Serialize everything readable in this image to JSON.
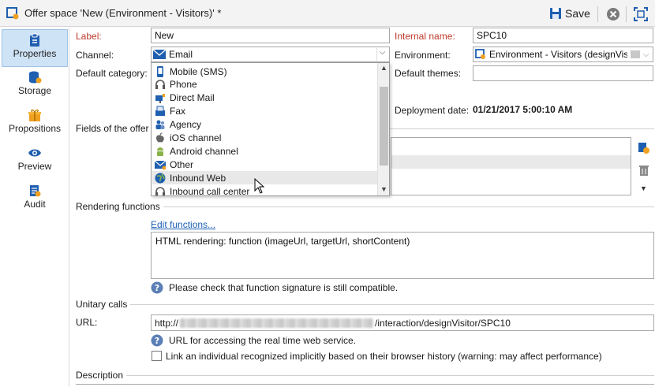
{
  "window": {
    "title": "Offer space 'New (Environment - Visitors)' *",
    "save_label": "Save"
  },
  "sidebar": {
    "items": [
      {
        "label": "Properties",
        "active": true,
        "icon": "clipboard-icon"
      },
      {
        "label": "Storage",
        "icon": "database-icon"
      },
      {
        "label": "Propositions",
        "icon": "gift-icon"
      },
      {
        "label": "Preview",
        "icon": "eye-icon"
      },
      {
        "label": "Audit",
        "icon": "audit-icon"
      }
    ]
  },
  "form": {
    "label_label": "Label:",
    "label_value": "New",
    "internal_name_label": "Internal name:",
    "internal_name_value": "SPC10",
    "channel_label": "Channel:",
    "channel_value": "Email",
    "environment_label": "Environment:",
    "environment_value": "Environment - Visitors (designVis",
    "default_category_label": "Default category:",
    "default_themes_label": "Default themes:",
    "deployment_date_label": "Deployment date:",
    "deployment_date_value": "01/21/2017 5:00:10 AM",
    "fields_label": "Fields of the offer"
  },
  "channel_dropdown": {
    "options": [
      {
        "label": "Mobile (SMS)",
        "icon": "mobile-icon"
      },
      {
        "label": "Phone",
        "icon": "headset-icon"
      },
      {
        "label": "Direct Mail",
        "icon": "mailbox-icon"
      },
      {
        "label": "Fax",
        "icon": "fax-icon"
      },
      {
        "label": "Agency",
        "icon": "people-icon"
      },
      {
        "label": "iOS channel",
        "icon": "apple-icon"
      },
      {
        "label": "Android channel",
        "icon": "android-icon"
      },
      {
        "label": "Other",
        "icon": "envelope-icon"
      },
      {
        "label": "Inbound Web",
        "icon": "globe-icon",
        "highlighted": true
      },
      {
        "label": "Inbound call center",
        "icon": "headset-icon"
      }
    ]
  },
  "rendering": {
    "section_title": "Rendering functions",
    "edit_link": "Edit functions...",
    "function_text": "HTML rendering: function (imageUrl, targetUrl, shortContent)",
    "help_text": "Please check that function signature is still compatible."
  },
  "unitary": {
    "section_title": "Unitary calls",
    "url_label": "URL:",
    "url_prefix": "http://",
    "url_suffix": "/interaction/designVisitor/SPC10",
    "url_help": "URL for accessing the real time web service.",
    "checkbox_label": "Link an individual recognized implicitly based on their browser history (warning: may affect performance)",
    "checkbox_checked": false
  },
  "description": {
    "section_title": "Description"
  },
  "colors": {
    "accent": "#1a5fb4",
    "required": "#c0392b",
    "active_tab": "#cfe3f7",
    "help_icon": "#5b7fb6",
    "orange": "#f0a020"
  }
}
